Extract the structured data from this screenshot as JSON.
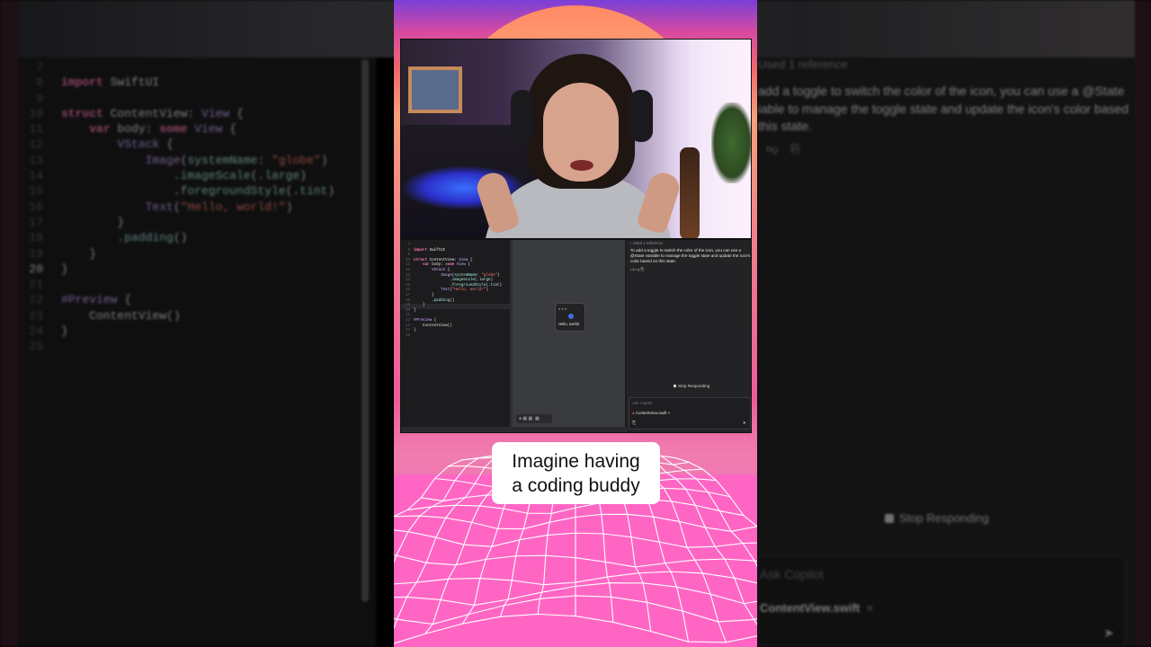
{
  "background_editor": {
    "lines": [
      {
        "num": "7",
        "html": ""
      },
      {
        "num": "8",
        "html": "<span class=\"kw\">import</span> SwiftUI"
      },
      {
        "num": "9",
        "html": ""
      },
      {
        "num": "10",
        "html": "<span class=\"kw\">struct</span> ContentView: <span class=\"ty\">View</span> {"
      },
      {
        "num": "11",
        "html": "    <span class=\"kw\">var</span> body: <span class=\"kw\">some</span> <span class=\"ty\">View</span> {"
      },
      {
        "num": "12",
        "html": "        <span class=\"ty\">VStack</span> {"
      },
      {
        "num": "13",
        "html": "            <span class=\"ty\">Image</span>(<span class=\"fn\">systemName</span>: <span class=\"str\">\"globe\"</span>)"
      },
      {
        "num": "14",
        "html": "                .<span class=\"fn\">imageScale</span>(.<span class=\"fn\">large</span>)"
      },
      {
        "num": "15",
        "html": "                .<span class=\"fn\">foregroundStyle</span>(.<span class=\"fn\">tint</span>)"
      },
      {
        "num": "16",
        "html": "            <span class=\"ty\">Text</span>(<span class=\"str\">\"Hello, world!\"</span>)"
      },
      {
        "num": "17",
        "html": "        }"
      },
      {
        "num": "18",
        "html": "        .<span class=\"fn\">padding</span>()"
      },
      {
        "num": "19",
        "html": "    }"
      },
      {
        "num": "20",
        "html": "}",
        "current": true
      },
      {
        "num": "21",
        "html": ""
      },
      {
        "num": "22",
        "html": "<span class=\"mac\">#Preview</span> {"
      },
      {
        "num": "23",
        "html": "    ContentView()"
      },
      {
        "num": "24",
        "html": "}"
      },
      {
        "num": "25",
        "html": ""
      }
    ]
  },
  "copilot": {
    "reference_label": "Used 1 reference",
    "answer_bg": "add a toggle to switch the color of the icon, you can use a @State iable to manage the toggle state and update the icon's color based this state.",
    "answer_full": "To add a toggle to switch the color of the icon, you can use a @State variable to manage the toggle state and update the icon's color based on this state.",
    "stop_label": "Stop Responding",
    "input_placeholder": "Ask Copilot",
    "file_chip": "ContentView.swift",
    "file_chip_remove": "×"
  },
  "mini_preview": {
    "text": "Hello, world!"
  },
  "caption": {
    "text": "Imagine having\na coding buddy"
  },
  "colors": {
    "keyword": "#ff7ab2",
    "type": "#d0a8ff",
    "string": "#ff8170",
    "caption_bg": "#ffffff",
    "terrain_line": "#ffffff",
    "terrain_fill": "#ff66c4"
  }
}
